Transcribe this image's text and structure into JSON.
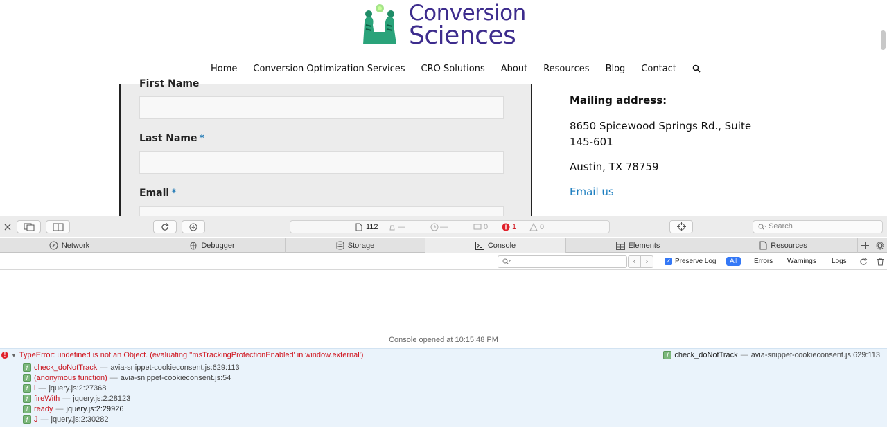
{
  "site": {
    "logo": {
      "line1": "Conversion",
      "line2": "Sciences"
    },
    "nav": [
      {
        "label": "Home"
      },
      {
        "label": "Conversion Optimization Services"
      },
      {
        "label": "CRO Solutions"
      },
      {
        "label": "About"
      },
      {
        "label": "Resources"
      },
      {
        "label": "Blog"
      },
      {
        "label": "Contact"
      }
    ],
    "form": {
      "first_name_label": "First Name",
      "last_name_label": "Last Name",
      "email_label": "Email",
      "required_mark": "*"
    },
    "contact": {
      "mailing_title": "Mailing address:",
      "street": "8650 Spicewood Springs Rd., Suite 145-601",
      "city": "Austin, TX 78759",
      "email_link": "Email us"
    }
  },
  "devtools": {
    "status": {
      "resources_count": "112",
      "requests_value": "—",
      "time_value": "—",
      "logs_count": "0",
      "errors_count": "1",
      "warnings_count": "0"
    },
    "search_placeholder": "Search",
    "tabs": [
      {
        "label": "Network",
        "icon": "network-icon"
      },
      {
        "label": "Debugger",
        "icon": "debugger-icon"
      },
      {
        "label": "Storage",
        "icon": "storage-icon"
      },
      {
        "label": "Console",
        "icon": "console-icon",
        "active": true
      },
      {
        "label": "Elements",
        "icon": "elements-icon"
      },
      {
        "label": "Resources",
        "icon": "resources-icon"
      }
    ],
    "filter": {
      "preserve_log_label": "Preserve Log",
      "preserve_log_checked": true,
      "levels": [
        "All",
        "Errors",
        "Warnings",
        "Logs"
      ],
      "active_level": "All"
    },
    "console": {
      "opened_message": "Console opened at 10:15:48 PM",
      "error_message": "TypeError: undefined is not an Object. (evaluating ''msTrackingProtectionEnabled' in window.external')",
      "error_origin_fn": "check_doNotTrack",
      "error_origin_loc": "avia-snippet-cookieconsent.js:629:113",
      "separator": "—",
      "stack": [
        {
          "fn": "check_doNotTrack",
          "loc": "avia-snippet-cookieconsent.js:629:113"
        },
        {
          "fn": "(anonymous function)",
          "loc": "avia-snippet-cookieconsent.js:54"
        },
        {
          "fn": "i",
          "loc": "jquery.js:2:27368"
        },
        {
          "fn": "fireWith",
          "loc": "jquery.js:2:28123"
        },
        {
          "fn": "ready",
          "loc": "jquery.js:2:29926"
        },
        {
          "fn": "J",
          "loc": "jquery.js:2:30282"
        }
      ]
    }
  },
  "colors": {
    "brand_purple": "#3d2c8d",
    "brand_green": "#2aa37a",
    "link_blue": "#1e7fc0",
    "error_red": "#d0141e",
    "accent_blue": "#3478f6",
    "error_row_bg": "#eaf3fb"
  }
}
